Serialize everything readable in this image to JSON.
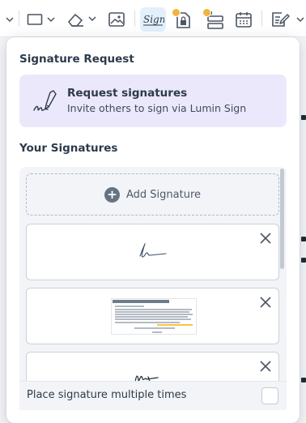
{
  "toolbar": {
    "items": [
      {
        "name": "chevron-down-icon"
      },
      {
        "name": "shape-rectangle-icon"
      },
      {
        "name": "eraser-icon"
      },
      {
        "name": "image-icon"
      },
      {
        "name": "sign-icon",
        "active": true
      },
      {
        "name": "document-lock-icon"
      },
      {
        "name": "form-fields-icon"
      },
      {
        "name": "calendar-icon"
      },
      {
        "name": "edit-document-icon"
      }
    ],
    "accent_active_bg": "#e3f0fb",
    "badge_color": "#f2b440"
  },
  "popover": {
    "signature_request": {
      "heading": "Signature Request",
      "card": {
        "title": "Request signatures",
        "subtitle": "Invite others to sign via Lumin Sign",
        "bg_color": "#ece8fb",
        "icon": "signature-pen-icon"
      }
    },
    "your_signatures": {
      "heading": "Your Signatures",
      "add_label": "Add Signature",
      "signatures": [
        {
          "type": "handwritten",
          "icon": "signature-scribble"
        },
        {
          "type": "document-thumbnail",
          "icon": "document-thumbnail"
        },
        {
          "type": "handwritten",
          "icon": "signature-scribble-2"
        }
      ]
    },
    "multi_place": {
      "label": "Place signature multiple times",
      "checked": false
    }
  }
}
